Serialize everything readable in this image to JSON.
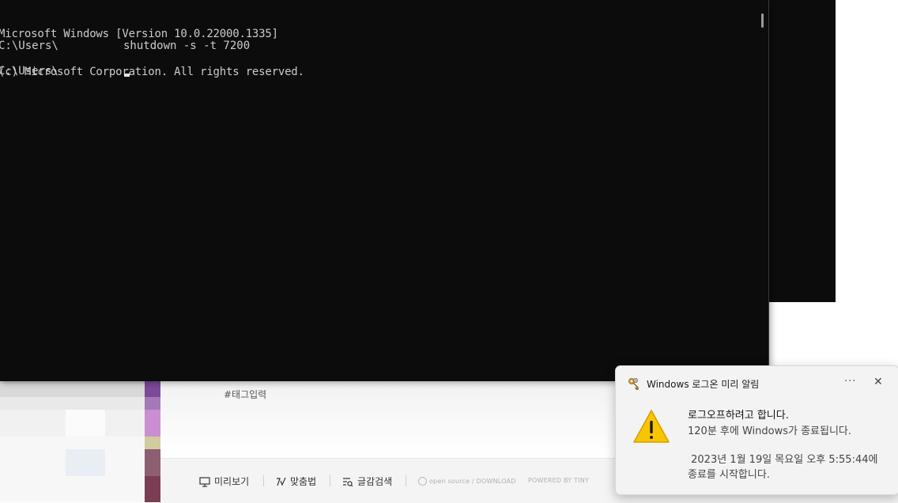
{
  "console": {
    "header_line1": "Microsoft Windows [Version 10.0.22000.1335]",
    "header_line2": "(c) Microsoft Corporation. All rights reserved.",
    "prompt1": "C:\\Users\\",
    "command1": "shutdown -s -t 7200",
    "prompt2": "C:\\Users\\"
  },
  "editor": {
    "tag_placeholder": "#태그입력",
    "toolbar": {
      "preview_label": "미리보기",
      "spellcheck_label": "맞춤법",
      "search_label": "글감검색",
      "open_source_label": "open source / DOWNLOAD",
      "powered_by_label": "POWERED BY TINY"
    }
  },
  "toast": {
    "app_name": "Windows 로그온 미리 알림",
    "more_label": "···",
    "close_label": "✕",
    "title": "로그오프하려고 합니다.",
    "line1": "120분 후에 Windows가 종료됩니다.",
    "line2": " 2023년 1월 19일 목요일 오후 5:55:44에",
    "line3": "종료를 시작합니다.",
    "warn_color": "#f7c600"
  }
}
